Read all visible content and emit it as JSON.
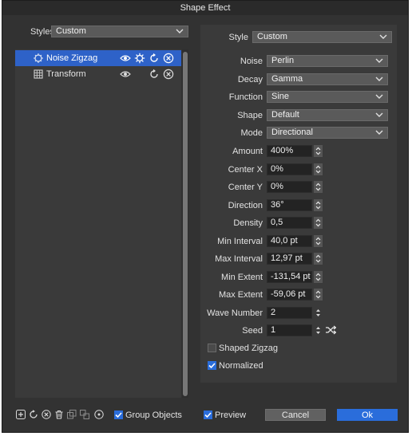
{
  "window": {
    "title": "Shape Effect"
  },
  "left": {
    "styles_label": "Styles",
    "styles_value": "Custom",
    "effects": [
      {
        "name": "Noise Zigzag",
        "icon": "zigzag-gear-icon",
        "selected": true
      },
      {
        "name": "Transform",
        "icon": "transform-grid-icon",
        "selected": false
      }
    ]
  },
  "right": {
    "style_label": "Style",
    "style_value": "Custom",
    "dropdowns": [
      {
        "label": "Noise",
        "value": "Perlin"
      },
      {
        "label": "Decay",
        "value": "Gamma"
      },
      {
        "label": "Function",
        "value": "Sine"
      },
      {
        "label": "Shape",
        "value": "Default"
      },
      {
        "label": "Mode",
        "value": "Directional"
      }
    ],
    "fields": [
      {
        "label": "Amount",
        "value": "400%"
      },
      {
        "label": "Center X",
        "value": "0%"
      },
      {
        "label": "Center Y",
        "value": "0%"
      },
      {
        "label": "Direction",
        "value": "36°"
      },
      {
        "label": "Density",
        "value": "0,5"
      },
      {
        "label": "Min Interval",
        "value": "40,0 pt"
      },
      {
        "label": "Max Interval",
        "value": "12,97 pt"
      },
      {
        "label": "Min Extent",
        "value": "-131,54 pt"
      },
      {
        "label": "Max Extent",
        "value": "-59,06 pt"
      },
      {
        "label": "Wave Number",
        "value": "2"
      },
      {
        "label": "Seed",
        "value": "1"
      }
    ],
    "checkboxes": [
      {
        "label": "Shaped Zigzag",
        "checked": false
      },
      {
        "label": "Normalized",
        "checked": true
      }
    ]
  },
  "footer": {
    "group_objects_label": "Group Objects",
    "group_objects_checked": true,
    "preview_label": "Preview",
    "preview_checked": true,
    "cancel_label": "Cancel",
    "ok_label": "Ok"
  },
  "colors": {
    "accent": "#2a6ddb",
    "selection": "#2e62c8",
    "dialog_bg": "#323232"
  }
}
